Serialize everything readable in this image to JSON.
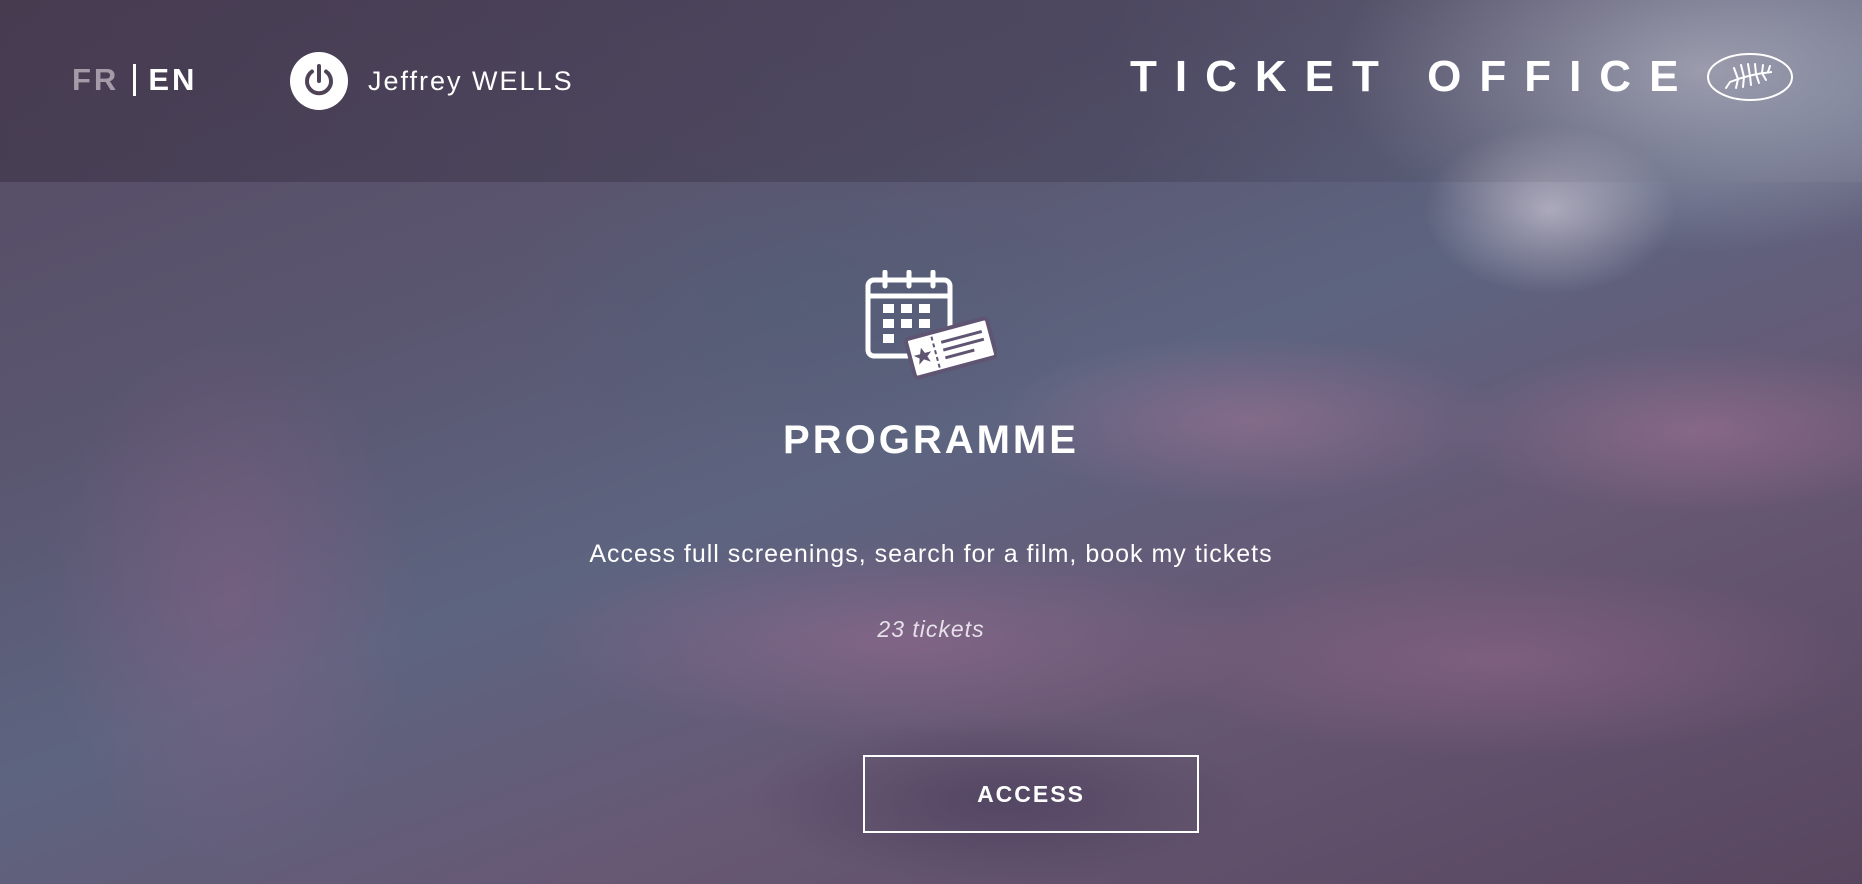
{
  "header": {
    "lang_fr": "FR",
    "lang_en": "EN",
    "active_lang": "EN",
    "user_name": "Jeffrey WELLS",
    "title": "TICKET OFFICE",
    "logo_icon": "palm-leaf-logo",
    "power_icon": "power-icon"
  },
  "main": {
    "icon": "calendar-ticket-icon",
    "title": "PROGRAMME",
    "description": "Access full screenings, search for a film, book my tickets",
    "ticket_count": "23 tickets",
    "access_label": "ACCESS"
  },
  "colors": {
    "text": "#ffffff",
    "inactive_lang": "#a59aa8"
  }
}
